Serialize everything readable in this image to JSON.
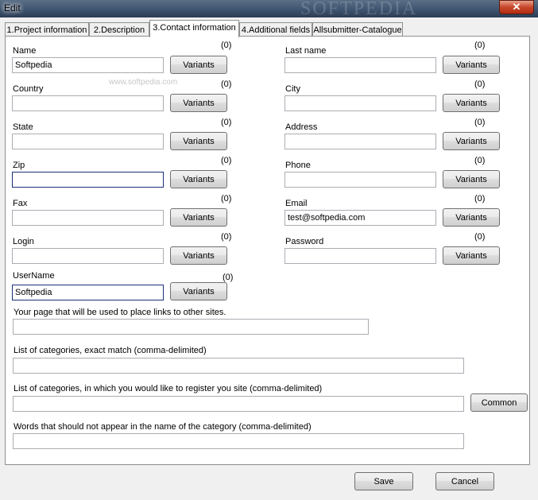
{
  "window": {
    "title": "Edit",
    "close_glyph": "✕",
    "watermark": "SOFTPEDIA"
  },
  "tabs": [
    {
      "label": "1.Project information"
    },
    {
      "label": "2.Description"
    },
    {
      "label": "3.Contact information"
    },
    {
      "label": "4.Additional fields"
    },
    {
      "label": "Allsubmitter-Catalogue"
    }
  ],
  "active_tab": "3.Contact information",
  "panel_watermark": "www.softpedia.com",
  "variants_label": "Variants",
  "fields": {
    "name": {
      "label": "Name",
      "value": "Softpedia",
      "count": "(0)"
    },
    "last_name": {
      "label": "Last name",
      "value": "",
      "count": "(0)"
    },
    "country": {
      "label": "Country",
      "value": "",
      "count": "(0)"
    },
    "city": {
      "label": "City",
      "value": "",
      "count": "(0)"
    },
    "state": {
      "label": "State",
      "value": "",
      "count": "(0)"
    },
    "address": {
      "label": "Address",
      "value": "",
      "count": "(0)"
    },
    "zip": {
      "label": "Zip",
      "value": "",
      "count": "(0)"
    },
    "phone": {
      "label": "Phone",
      "value": "",
      "count": "(0)"
    },
    "fax": {
      "label": "Fax",
      "value": "",
      "count": "(0)"
    },
    "email": {
      "label": "Email",
      "value": "test@softpedia.com",
      "count": "(0)"
    },
    "login": {
      "label": "Login",
      "value": "",
      "count": "(0)"
    },
    "password": {
      "label": "Password",
      "value": "",
      "count": "(0)"
    },
    "username": {
      "label": "UserName",
      "value": "Softpedia",
      "count": "(0)"
    }
  },
  "links_page": {
    "label": "Your page that will be used to place links to other sites.",
    "value": ""
  },
  "categories_exact": {
    "label": "List of categories, exact match (comma-delimited)",
    "value": ""
  },
  "categories_register": {
    "label": "List of categories, in which you would like to register you site (comma-delimited)",
    "value": "",
    "button": "Common"
  },
  "words_exclude": {
    "label": "Words that should not appear in the name of the category (comma-delimited)",
    "value": ""
  },
  "footer": {
    "save": "Save",
    "cancel": "Cancel"
  }
}
